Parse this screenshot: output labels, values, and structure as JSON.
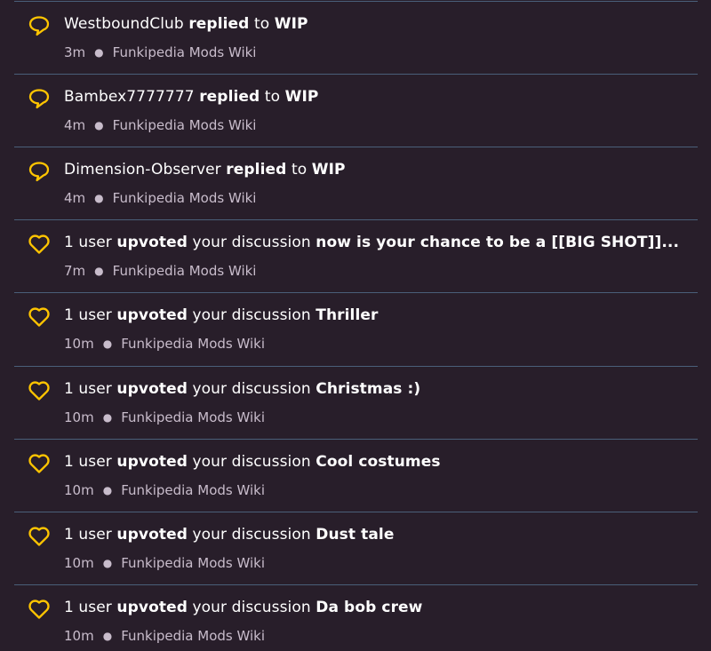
{
  "accent_color": "#ffc500",
  "notifications": [
    {
      "type": "reply",
      "icon": "speech-bubble-icon",
      "actor": "WestboundClub",
      "action": "replied",
      "connector": "to",
      "target": "WIP",
      "time": "3m",
      "wiki": "Funkipedia Mods Wiki"
    },
    {
      "type": "reply",
      "icon": "speech-bubble-icon",
      "actor": "Bambex7777777",
      "action": "replied",
      "connector": "to",
      "target": "WIP",
      "time": "4m",
      "wiki": "Funkipedia Mods Wiki"
    },
    {
      "type": "reply",
      "icon": "speech-bubble-icon",
      "actor": "Dimension-Observer",
      "action": "replied",
      "connector": "to",
      "target": "WIP",
      "time": "4m",
      "wiki": "Funkipedia Mods Wiki"
    },
    {
      "type": "upvote",
      "icon": "heart-icon",
      "actor": "1 user",
      "action": "upvoted",
      "connector": "your discussion",
      "target": "now is your chance to be a [[BIG SHOT]]...",
      "time": "7m",
      "wiki": "Funkipedia Mods Wiki"
    },
    {
      "type": "upvote",
      "icon": "heart-icon",
      "actor": "1 user",
      "action": "upvoted",
      "connector": "your discussion",
      "target": "Thriller",
      "time": "10m",
      "wiki": "Funkipedia Mods Wiki"
    },
    {
      "type": "upvote",
      "icon": "heart-icon",
      "actor": "1 user",
      "action": "upvoted",
      "connector": "your discussion",
      "target": "Christmas :)",
      "time": "10m",
      "wiki": "Funkipedia Mods Wiki"
    },
    {
      "type": "upvote",
      "icon": "heart-icon",
      "actor": "1 user",
      "action": "upvoted",
      "connector": "your discussion",
      "target": "Cool costumes",
      "time": "10m",
      "wiki": "Funkipedia Mods Wiki"
    },
    {
      "type": "upvote",
      "icon": "heart-icon",
      "actor": "1 user",
      "action": "upvoted",
      "connector": "your discussion",
      "target": "Dust tale",
      "time": "10m",
      "wiki": "Funkipedia Mods Wiki"
    },
    {
      "type": "upvote",
      "icon": "heart-icon",
      "actor": "1 user",
      "action": "upvoted",
      "connector": "your discussion",
      "target": "Da bob crew",
      "time": "10m",
      "wiki": "Funkipedia Mods Wiki"
    }
  ]
}
